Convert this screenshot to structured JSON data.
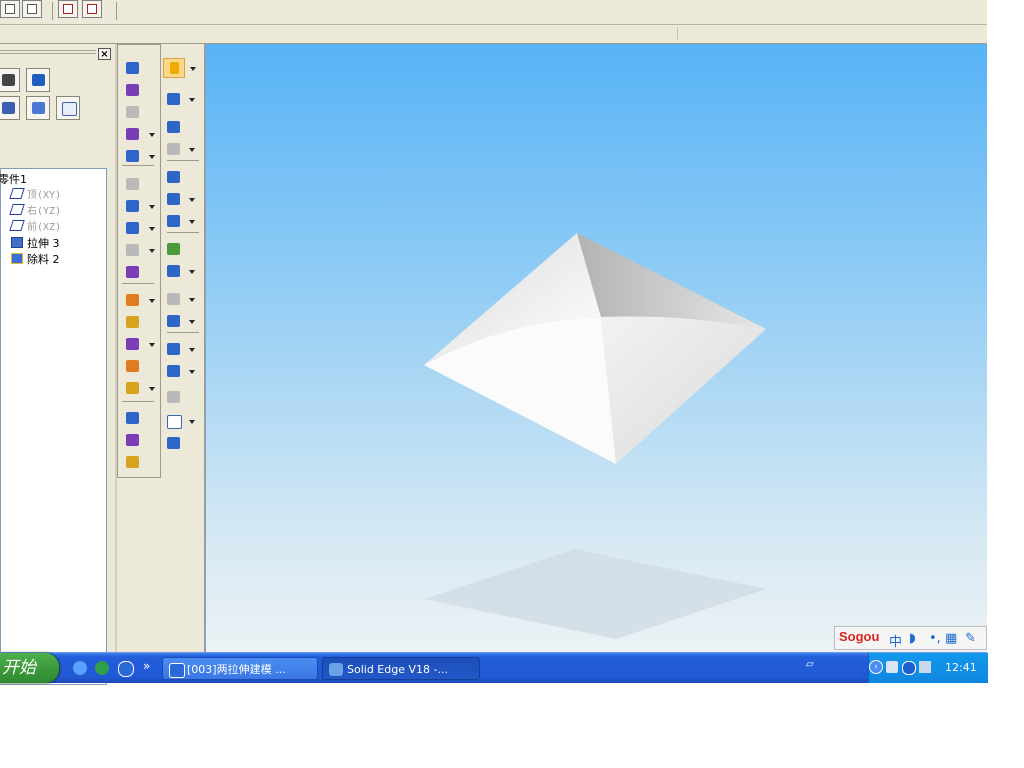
{
  "toolbar": {
    "buttons": [
      "toolbar-button-1",
      "toolbar-button-2",
      "toolbar-button-3",
      "toolbar-button-4"
    ]
  },
  "pathfinder": {
    "close_label": "×",
    "tree": {
      "root": "零件1",
      "items": [
        {
          "label": "顶(XY)",
          "icon": "reference-plane-icon",
          "dim": true
        },
        {
          "label": "右(YZ)",
          "icon": "reference-plane-icon",
          "dim": true
        },
        {
          "label": "前(XZ)",
          "icon": "reference-plane-icon",
          "dim": true
        },
        {
          "label": "拉伸 3",
          "icon": "extrude-feature-icon",
          "dim": false
        },
        {
          "label": "除料 2",
          "icon": "cut-feature-icon",
          "dim": false
        }
      ]
    }
  },
  "feature_toolbar": {
    "select_tool": "select-arrow-icon"
  },
  "viewport": {
    "model": "pyramid-solid",
    "background_top": "#57b3f6",
    "background_bottom": "#ecf2f5"
  },
  "ime": {
    "logo": "Sogou",
    "mode": "中"
  },
  "taskbar": {
    "start_label": "开始",
    "tasks": [
      {
        "label": "[003]两拉伸建模 ..."
      },
      {
        "label": "Solid Edge V18 -..."
      }
    ],
    "clock": "12:41"
  }
}
